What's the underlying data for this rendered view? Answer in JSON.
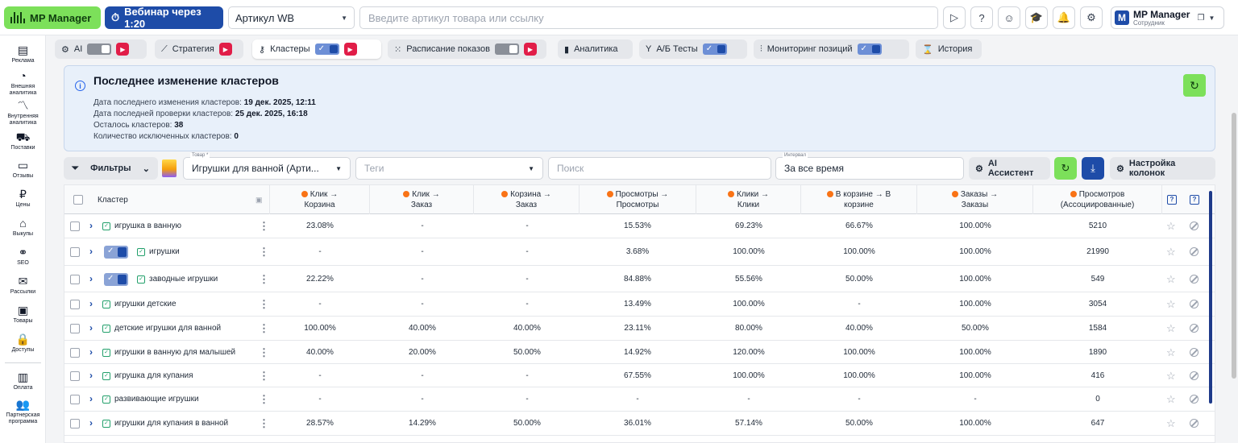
{
  "topbar": {
    "logo_label": "MP Manager",
    "webinar_label": "Вебинар через 1:20",
    "article_select": "Артикул WB",
    "article_placeholder": "Введите артикул товара или ссылку",
    "account_name": "MP Manager",
    "account_role": "Сотрудник",
    "account_initial": "M"
  },
  "sidebar": [
    {
      "label": "Реклама",
      "icon": "ads-icon"
    },
    {
      "label": "Внешняя аналитика",
      "icon": "pie-chart-icon"
    },
    {
      "label": "Внутренняя аналитика",
      "icon": "trend-icon"
    },
    {
      "label": "Поставки",
      "icon": "truck-icon"
    },
    {
      "label": "Отзывы",
      "icon": "chat-icon"
    },
    {
      "label": "Цены",
      "icon": "ruble-icon"
    },
    {
      "label": "Выкупы",
      "icon": "store-icon"
    },
    {
      "label": "SEO",
      "icon": "share-icon"
    },
    {
      "label": "Рассылки",
      "icon": "mail-icon"
    },
    {
      "label": "Товары",
      "icon": "box-icon"
    },
    {
      "label": "Доступы",
      "icon": "lock-icon"
    },
    {
      "label": "Оплата",
      "icon": "wallet-icon"
    },
    {
      "label": "Партнерская программа",
      "icon": "users-icon"
    }
  ],
  "tabs": [
    {
      "label": "AI",
      "icon": "chip-icon"
    },
    {
      "label": "Стратегия",
      "icon": "chart-line-icon"
    },
    {
      "label": "Кластеры",
      "icon": "key-icon"
    },
    {
      "label": "Расписание показов",
      "icon": "grid-icon"
    },
    {
      "label": "Аналитика",
      "icon": "bar-chart-icon"
    },
    {
      "label": "А/Б Тесты",
      "icon": "split-icon"
    },
    {
      "label": "Мониторинг позиций",
      "icon": "sliders-icon"
    },
    {
      "label": "История",
      "icon": "history-icon"
    }
  ],
  "info": {
    "title": "Последнее изменение кластеров",
    "lines": [
      {
        "label": "Дата последнего изменения кластеров: ",
        "value": "19 дек. 2025, 12:11"
      },
      {
        "label": "Дата последней проверки кластеров: ",
        "value": "25 дек. 2025, 16:18"
      },
      {
        "label": "Осталось кластеров: ",
        "value": "38"
      },
      {
        "label": "Количество исключенных кластеров: ",
        "value": "0"
      }
    ]
  },
  "filters": {
    "filters_label": "Фильтры",
    "product_label": "Товар *",
    "product_value": "Игрушки для ванной (Арти...",
    "tags_placeholder": "Теги",
    "search_placeholder": "Поиск",
    "interval_label": "Интервал",
    "interval_value": "За все время",
    "ai_assistant": "AI Ассистент",
    "columns_settings": "Настройка колонок"
  },
  "table": {
    "headers": [
      "Кластер",
      "Клик → Корзина",
      "Клик → Заказ",
      "Корзина → Заказ",
      "Просмотры → Просмотры",
      "Клики → Клики",
      "В корзине → В корзине",
      "Заказы → Заказы",
      "Просмотров (Ассоциированные)"
    ],
    "rows": [
      {
        "name": "игрушка в ванную",
        "toggle": false,
        "v": [
          "23.08%",
          "-",
          "-",
          "15.53%",
          "69.23%",
          "66.67%",
          "100.00%",
          "5210"
        ]
      },
      {
        "name": "игрушки",
        "toggle": true,
        "v": [
          "-",
          "-",
          "-",
          "3.68%",
          "100.00%",
          "100.00%",
          "100.00%",
          "21990"
        ]
      },
      {
        "name": "заводные игрушки",
        "toggle": true,
        "v": [
          "22.22%",
          "-",
          "-",
          "84.88%",
          "55.56%",
          "50.00%",
          "100.00%",
          "549"
        ]
      },
      {
        "name": "игрушки детские",
        "toggle": false,
        "v": [
          "-",
          "-",
          "-",
          "13.49%",
          "100.00%",
          "-",
          "100.00%",
          "3054"
        ]
      },
      {
        "name": "детские игрушки для ванной",
        "toggle": false,
        "v": [
          "100.00%",
          "40.00%",
          "40.00%",
          "23.11%",
          "80.00%",
          "40.00%",
          "50.00%",
          "1584"
        ]
      },
      {
        "name": "игрушки в ванную для малышей",
        "toggle": false,
        "v": [
          "40.00%",
          "20.00%",
          "50.00%",
          "14.92%",
          "120.00%",
          "100.00%",
          "100.00%",
          "1890"
        ]
      },
      {
        "name": "игрушка для купания",
        "toggle": false,
        "v": [
          "-",
          "-",
          "-",
          "67.55%",
          "100.00%",
          "100.00%",
          "100.00%",
          "416"
        ]
      },
      {
        "name": "развивающие игрушки",
        "toggle": false,
        "v": [
          "-",
          "-",
          "-",
          "-",
          "-",
          "-",
          "-",
          "0"
        ]
      },
      {
        "name": "игрушки для купания в ванной",
        "toggle": false,
        "v": [
          "28.57%",
          "14.29%",
          "50.00%",
          "36.01%",
          "57.14%",
          "50.00%",
          "100.00%",
          "647"
        ]
      }
    ]
  },
  "colors": {
    "accent": "#1e4ca8",
    "brand_green": "#7ce05a",
    "metric_dot": "#f97316"
  }
}
